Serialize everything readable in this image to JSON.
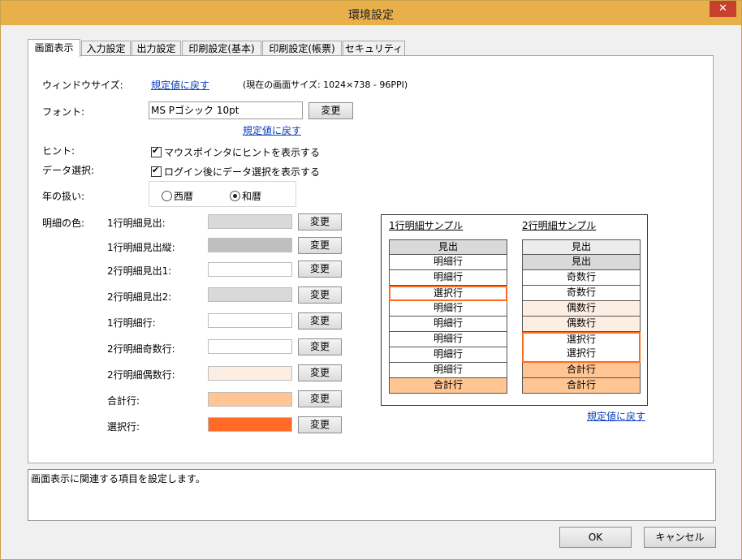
{
  "window": {
    "title": "環境設定",
    "close_label": "✕"
  },
  "tabs": [
    {
      "label": "画面表示",
      "active": true
    },
    {
      "label": "入力設定"
    },
    {
      "label": "出力設定"
    },
    {
      "label": "印刷設定(基本)"
    },
    {
      "label": "印刷設定(帳票)"
    },
    {
      "label": "セキュリティ"
    }
  ],
  "window_size": {
    "label": "ウィンドウサイズ:",
    "reset_link": "規定値に戻す",
    "current_info": "(現在の画面サイズ: 1024×738 - 96PPI)"
  },
  "font": {
    "label": "フォント:",
    "value": "MS Pゴシック 10pt",
    "change_label": "変更",
    "reset_link": "規定値に戻す"
  },
  "hint": {
    "label": "ヒント:",
    "checkbox_label": "マウスポインタにヒントを表示する",
    "checked": true
  },
  "data_select": {
    "label": "データ選択:",
    "checkbox_label": "ログイン後にデータ選択を表示する",
    "checked": true
  },
  "year": {
    "label": "年の扱い:",
    "option_western": "西暦",
    "option_japanese": "和暦",
    "selected": "和暦"
  },
  "colors": {
    "label": "明細の色:",
    "change_label": "変更",
    "items": [
      {
        "label": "1行明細見出:",
        "color": "#d9d9d9"
      },
      {
        "label": "1行明細見出縦:",
        "color": "#bfbfbf"
      },
      {
        "label": "2行明細見出1:",
        "color": "#ffffff"
      },
      {
        "label": "2行明細見出2:",
        "color": "#d9d9d9"
      },
      {
        "label": "1行明細行:",
        "color": "#ffffff"
      },
      {
        "label": "2行明細奇数行:",
        "color": "#ffffff"
      },
      {
        "label": "2行明細偶数行:",
        "color": "#fdeee3"
      },
      {
        "label": "合計行:",
        "color": "#ffc592"
      },
      {
        "label": "選択行:",
        "color": "#ff6a26"
      }
    ]
  },
  "sample1": {
    "title": "1行明細サンプル",
    "rows": [
      {
        "text": "見出",
        "bg": "#d9d9d9"
      },
      {
        "text": "明細行",
        "bg": "#ffffff"
      },
      {
        "text": "明細行",
        "bg": "#ffffff"
      },
      {
        "text": "選択行",
        "bg": "#ffffff",
        "selected": true
      },
      {
        "text": "明細行",
        "bg": "#ffffff"
      },
      {
        "text": "明細行",
        "bg": "#ffffff"
      },
      {
        "text": "明細行",
        "bg": "#ffffff"
      },
      {
        "text": "明細行",
        "bg": "#ffffff"
      },
      {
        "text": "明細行",
        "bg": "#ffffff"
      },
      {
        "text": "合計行",
        "bg": "#ffc592"
      }
    ]
  },
  "sample2": {
    "title": "2行明細サンプル",
    "rows": [
      {
        "text": "見出",
        "bg": "#ececec"
      },
      {
        "text": "見出",
        "bg": "#d9d9d9"
      },
      {
        "text": "奇数行",
        "bg": "#ffffff"
      },
      {
        "text": "奇数行",
        "bg": "#ffffff"
      },
      {
        "text": "偶数行",
        "bg": "#fdeee3"
      },
      {
        "text": "偶数行",
        "bg": "#fdeee3"
      },
      {
        "text": "選択行",
        "bg": "#ffffff",
        "selected": true
      },
      {
        "text": "選択行",
        "bg": "#ffffff",
        "selected": true
      },
      {
        "text": "合計行",
        "bg": "#ffc592"
      },
      {
        "text": "合計行",
        "bg": "#ffc592"
      }
    ]
  },
  "sample_reset_link": "規定値に戻す",
  "description": "画面表示に関連する項目を設定します。",
  "buttons": {
    "ok": "OK",
    "cancel": "キャンセル"
  }
}
